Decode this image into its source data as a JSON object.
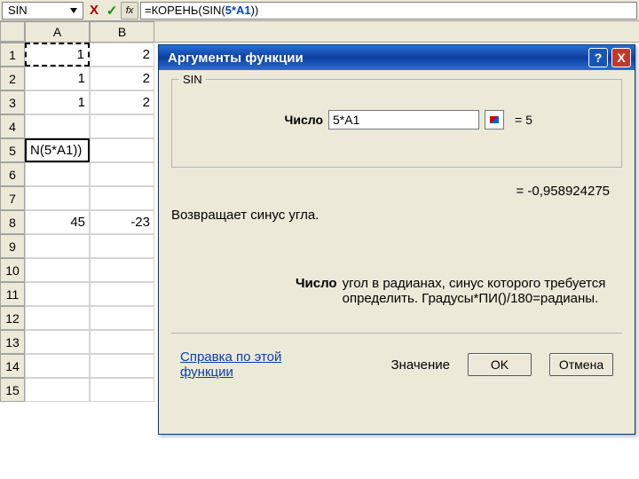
{
  "formula_bar": {
    "name_box": "SIN",
    "cancel_glyph": "X",
    "confirm_glyph": "✓",
    "fx_label": "fx",
    "formula_prefix": "=КОРЕНЬ(",
    "formula_fn": "SIN",
    "formula_open": "(",
    "formula_arg": "5*A1",
    "formula_close": "))"
  },
  "grid": {
    "columns": [
      "A",
      "B"
    ],
    "rows": [
      {
        "n": "1",
        "A": "1",
        "B": "2"
      },
      {
        "n": "2",
        "A": "1",
        "B": "2"
      },
      {
        "n": "3",
        "A": "1",
        "B": "2"
      },
      {
        "n": "4",
        "A": "",
        "B": ""
      },
      {
        "n": "5",
        "A": "N(5*A1))",
        "B": ""
      },
      {
        "n": "6",
        "A": "",
        "B": ""
      },
      {
        "n": "7",
        "A": "",
        "B": ""
      },
      {
        "n": "8",
        "A": "45",
        "B": "-23"
      },
      {
        "n": "9",
        "A": "",
        "B": ""
      },
      {
        "n": "10",
        "A": "",
        "B": ""
      },
      {
        "n": "11",
        "A": "",
        "B": ""
      },
      {
        "n": "12",
        "A": "",
        "B": ""
      },
      {
        "n": "13",
        "A": "",
        "B": ""
      },
      {
        "n": "14",
        "A": "",
        "B": ""
      },
      {
        "n": "15",
        "A": "",
        "B": ""
      }
    ],
    "marching_cell": "A1",
    "active_cell": "A5"
  },
  "dialog": {
    "title": "Аргументы функции",
    "help_glyph": "?",
    "close_glyph": "X",
    "legend": "SIN",
    "arg": {
      "label": "Число",
      "value": "5*A1",
      "evaluated": "= 5"
    },
    "result": "= -0,958924275",
    "description": "Возвращает синус угла.",
    "arg_help_label": "Число",
    "arg_help_text": "угол в радианах, синус которого требуется определить. Градусы*ПИ()/180=радианы.",
    "help_link": "Справка по этой функции",
    "value_label": "Значение",
    "ok": "OK",
    "cancel": "Отмена"
  }
}
